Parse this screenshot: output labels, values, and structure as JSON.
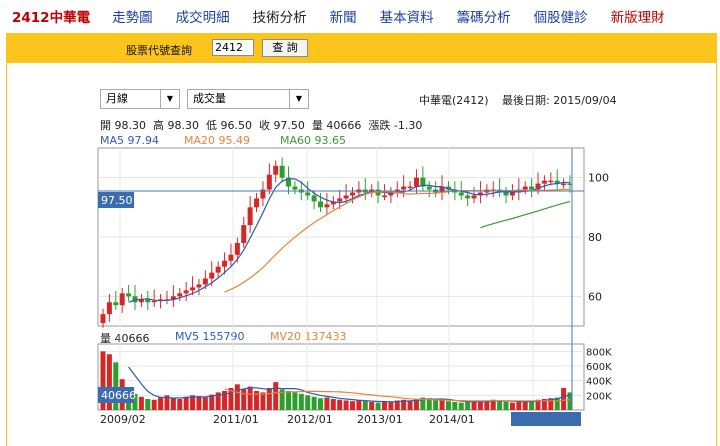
{
  "nav": {
    "title": "2412中華電",
    "items": [
      "走勢圖",
      "成交明細",
      "技術分析",
      "新聞",
      "基本資料",
      "籌碼分析",
      "個股健診",
      "新版理財"
    ]
  },
  "query": {
    "label": "股票代號查詢",
    "value": "2412",
    "button": "查 詢"
  },
  "controls": {
    "period": "月線",
    "indicator": "成交量"
  },
  "header": {
    "name": "中華電(2412)",
    "date_label": "最後日期: 2015/09/04"
  },
  "ohlc": {
    "text": "開 98.30  高 98.30  低 96.50  收 97.50  量 40666  漲跌 -1.30"
  },
  "ma_labels": {
    "ma5": "MA5 97.94",
    "ma20": "MA20 95.49",
    "ma60": "MA60 93.65"
  },
  "vol_labels": {
    "vol": "量 40666",
    "mv5": "MV5 155790",
    "mv20": "MV20 137433"
  },
  "colors": {
    "up": "#d62728",
    "down": "#2ca02c",
    "ma5": "#2f5bb5",
    "ma20": "#e8843a",
    "ma60": "#3a9a3a",
    "nav_bar": "#fcc51d",
    "cursor": "#4a7ab5"
  },
  "chart_data": [
    {
      "type": "candlestick",
      "price_axis": {
        "ticks": [
          60,
          80,
          100
        ],
        "range": [
          50,
          110
        ]
      },
      "last_price_label": "97.50",
      "x_tick_labels": [
        "2009/02",
        "2011/01",
        "2012/01",
        "2013/01",
        "2014/01",
        "2015 09/04"
      ],
      "ma_series": [
        "MA5",
        "MA20",
        "MA60"
      ]
    },
    {
      "type": "bar",
      "volume_axis": {
        "ticks": [
          "800K",
          "600K",
          "400K",
          "200K"
        ],
        "range": [
          0,
          900
        ]
      },
      "last_volume_label": "40666",
      "series": [
        "MV5",
        "MV20"
      ]
    }
  ]
}
